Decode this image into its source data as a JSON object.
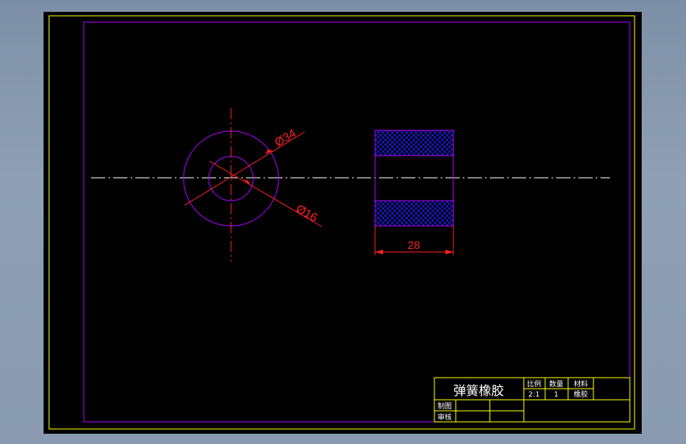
{
  "colors": {
    "background": "#000000",
    "frame": "#ffff00",
    "border": "#b000ff",
    "dimension": "#ff2020",
    "centerline": "#ffffff",
    "hatch": "#2020ff",
    "title_text": "#ffffff"
  },
  "dimensions": {
    "outer_diameter": "Ø34",
    "inner_diameter": "Ø16",
    "length": "28"
  },
  "title_block": {
    "part_name": "弹簧橡胶",
    "scale_label": "比例",
    "scale_value": "2:1",
    "quantity_label": "数量",
    "quantity_value": "1",
    "material_label": "材料",
    "material_value": "橡胶",
    "drawn_label": "制图",
    "checked_label": "审核"
  }
}
